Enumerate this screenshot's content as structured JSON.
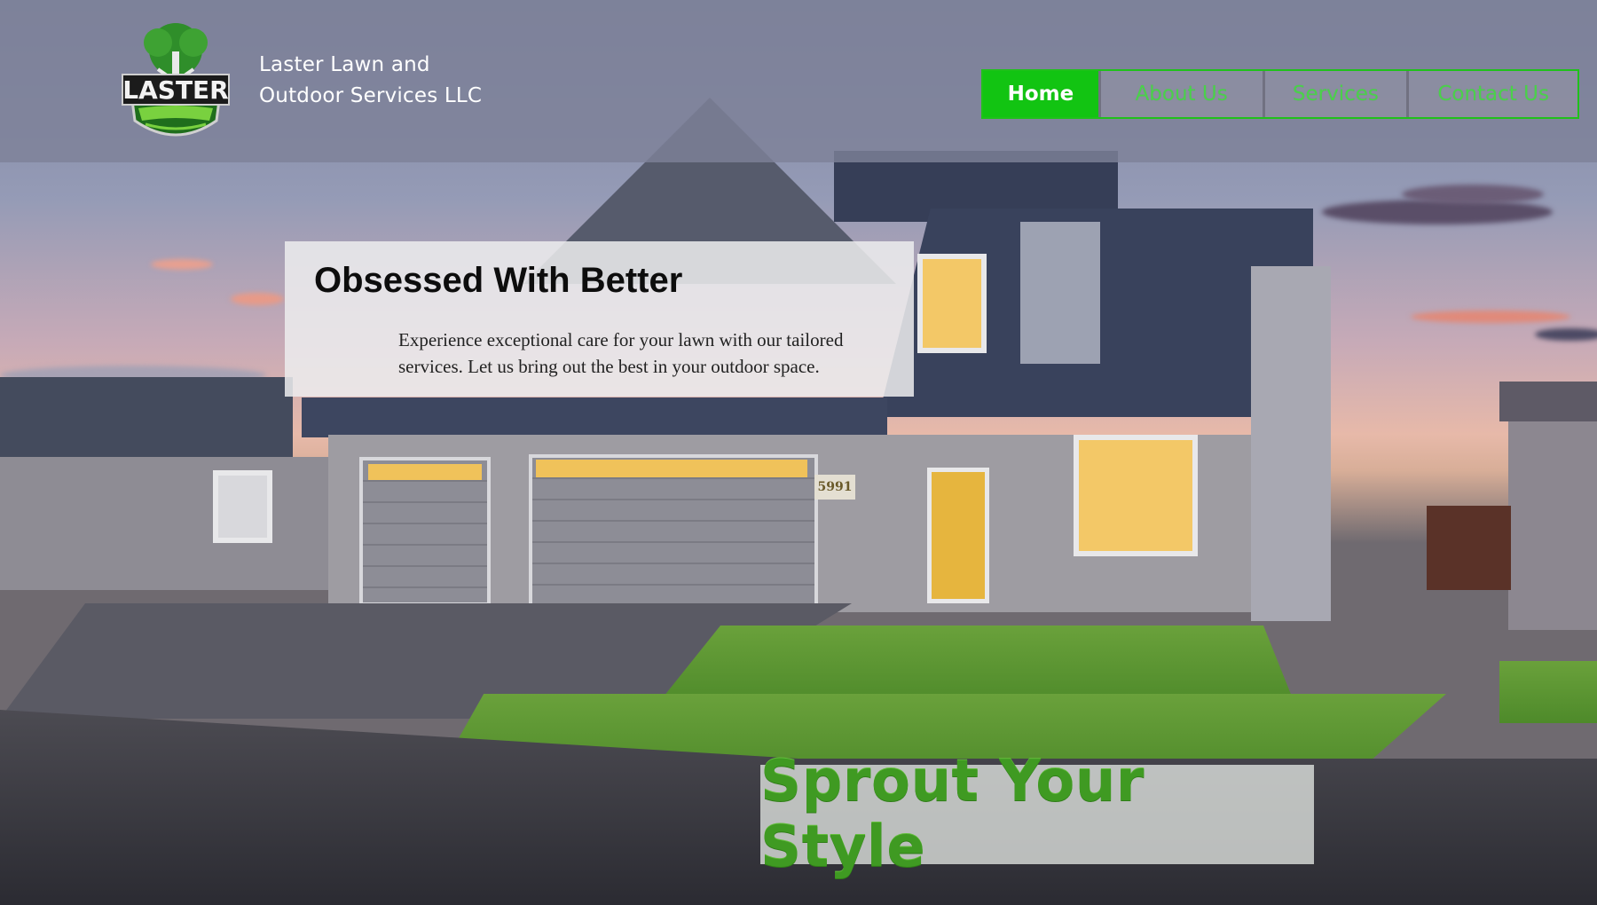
{
  "header": {
    "logo": {
      "icon": "tree-shield-logo-icon",
      "logo_text": "LASTER",
      "logo_subtext": "LAWN AND OUTDOOR SERVICES LLC",
      "logo_tagline": "OBSESSED WITH BETTER"
    },
    "brand_line1": "Laster Lawn and",
    "brand_line2": "Outdoor Services LLC"
  },
  "nav": {
    "items": [
      {
        "label": "Home",
        "active": true
      },
      {
        "label": "About Us",
        "active": false
      },
      {
        "label": "Services",
        "active": false
      },
      {
        "label": "Contact Us",
        "active": false
      }
    ]
  },
  "hero": {
    "title": "Obsessed With Better",
    "text": "Experience exceptional care for your lawn with our tailored services. Let us bring out the best in your outdoor space."
  },
  "slogan": "Sprout Your Style",
  "house_number": "5991",
  "colors": {
    "accent_green": "#12c412",
    "nav_text_green": "#4ad24a",
    "slogan_green": "#3f9a22",
    "header_bg": "#7e8198"
  }
}
